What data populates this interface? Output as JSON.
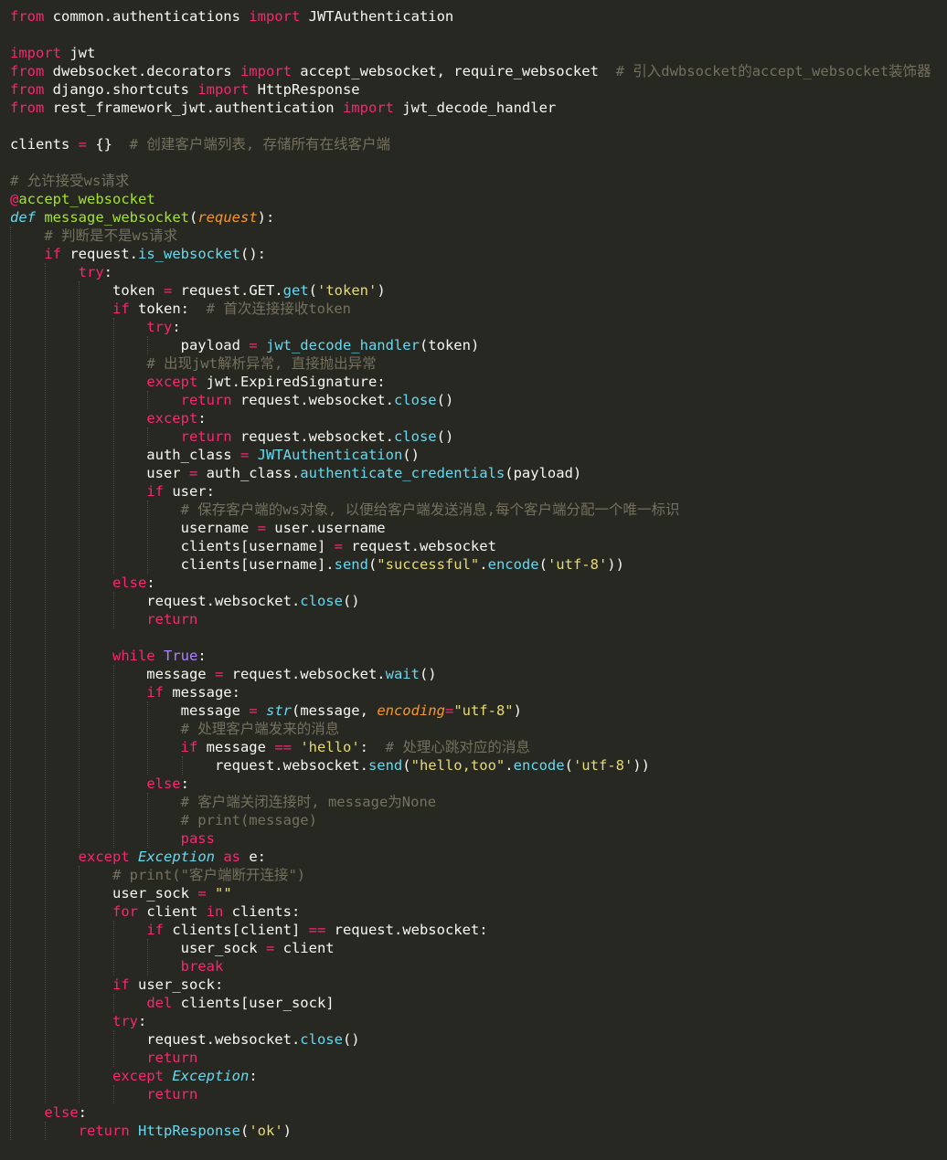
{
  "editor": {
    "theme_colors": {
      "background": "#272822",
      "text": "#f8f8f2",
      "keyword": "#f92672",
      "function": "#a6e22e",
      "builtin": "#66d9ef",
      "string": "#e6db74",
      "comment": "#75715e",
      "parameter": "#fd971f",
      "constant": "#ae81ff"
    },
    "lines": [
      [
        [
          "kw",
          "from"
        ],
        [
          "txt",
          " common.authentications "
        ],
        [
          "kw",
          "import"
        ],
        [
          "txt",
          " JWTAuthentication"
        ]
      ],
      [],
      [
        [
          "kw",
          "import"
        ],
        [
          "txt",
          " jwt"
        ]
      ],
      [
        [
          "kw",
          "from"
        ],
        [
          "txt",
          " dwebsocket.decorators "
        ],
        [
          "kw",
          "import"
        ],
        [
          "txt",
          " accept_websocket, require_websocket  "
        ],
        [
          "cm",
          "# 引入dwbsocket的accept_websocket装饰器"
        ]
      ],
      [
        [
          "kw",
          "from"
        ],
        [
          "txt",
          " django.shortcuts "
        ],
        [
          "kw",
          "import"
        ],
        [
          "txt",
          " HttpResponse"
        ]
      ],
      [
        [
          "kw",
          "from"
        ],
        [
          "txt",
          " rest_framework_jwt.authentication "
        ],
        [
          "kw",
          "import"
        ],
        [
          "txt",
          " jwt_decode_handler"
        ]
      ],
      [],
      [
        [
          "txt",
          "clients "
        ],
        [
          "op",
          "="
        ],
        [
          "txt",
          " {}  "
        ],
        [
          "cm",
          "# 创建客户端列表, 存储所有在线客户端"
        ]
      ],
      [],
      [
        [
          "cm",
          "# 允许接受ws请求"
        ]
      ],
      [
        [
          "dec",
          "@"
        ],
        [
          "fn",
          "accept_websocket"
        ]
      ],
      [
        [
          "cls",
          "def"
        ],
        [
          "txt",
          " "
        ],
        [
          "fn",
          "message_websocket"
        ],
        [
          "txt",
          "("
        ],
        [
          "prm",
          "request"
        ],
        [
          "txt",
          "):"
        ]
      ],
      [
        [
          "txt",
          "    "
        ],
        [
          "cm",
          "# 判断是不是ws请求"
        ]
      ],
      [
        [
          "txt",
          "    "
        ],
        [
          "kw",
          "if"
        ],
        [
          "txt",
          " request."
        ],
        [
          "bi",
          "is_websocket"
        ],
        [
          "txt",
          "():"
        ]
      ],
      [
        [
          "txt",
          "        "
        ],
        [
          "kw",
          "try"
        ],
        [
          "txt",
          ":"
        ]
      ],
      [
        [
          "txt",
          "            token "
        ],
        [
          "op",
          "="
        ],
        [
          "txt",
          " request.GET."
        ],
        [
          "bi",
          "get"
        ],
        [
          "txt",
          "("
        ],
        [
          "str",
          "'token'"
        ],
        [
          "txt",
          ")"
        ]
      ],
      [
        [
          "txt",
          "            "
        ],
        [
          "kw",
          "if"
        ],
        [
          "txt",
          " token:  "
        ],
        [
          "cm",
          "# 首次连接接收token"
        ]
      ],
      [
        [
          "txt",
          "                "
        ],
        [
          "kw",
          "try"
        ],
        [
          "txt",
          ":"
        ]
      ],
      [
        [
          "txt",
          "                    payload "
        ],
        [
          "op",
          "="
        ],
        [
          "txt",
          " "
        ],
        [
          "bi",
          "jwt_decode_handler"
        ],
        [
          "txt",
          "(token)"
        ]
      ],
      [
        [
          "txt",
          "                "
        ],
        [
          "cm",
          "# 出现jwt解析异常, 直接抛出异常"
        ]
      ],
      [
        [
          "txt",
          "                "
        ],
        [
          "kw",
          "except"
        ],
        [
          "txt",
          " jwt.ExpiredSignature:"
        ]
      ],
      [
        [
          "txt",
          "                    "
        ],
        [
          "kw",
          "return"
        ],
        [
          "txt",
          " request.websocket."
        ],
        [
          "bi",
          "close"
        ],
        [
          "txt",
          "()"
        ]
      ],
      [
        [
          "txt",
          "                "
        ],
        [
          "kw",
          "except"
        ],
        [
          "txt",
          ":"
        ]
      ],
      [
        [
          "txt",
          "                    "
        ],
        [
          "kw",
          "return"
        ],
        [
          "txt",
          " request.websocket."
        ],
        [
          "bi",
          "close"
        ],
        [
          "txt",
          "()"
        ]
      ],
      [
        [
          "txt",
          "                auth_class "
        ],
        [
          "op",
          "="
        ],
        [
          "txt",
          " "
        ],
        [
          "bi",
          "JWTAuthentication"
        ],
        [
          "txt",
          "()"
        ]
      ],
      [
        [
          "txt",
          "                user "
        ],
        [
          "op",
          "="
        ],
        [
          "txt",
          " auth_class."
        ],
        [
          "bi",
          "authenticate_credentials"
        ],
        [
          "txt",
          "(payload)"
        ]
      ],
      [
        [
          "txt",
          "                "
        ],
        [
          "kw",
          "if"
        ],
        [
          "txt",
          " user:"
        ]
      ],
      [
        [
          "txt",
          "                    "
        ],
        [
          "cm",
          "# 保存客户端的ws对象, 以便给客户端发送消息,每个客户端分配一个唯一标识"
        ]
      ],
      [
        [
          "txt",
          "                    username "
        ],
        [
          "op",
          "="
        ],
        [
          "txt",
          " user.username"
        ]
      ],
      [
        [
          "txt",
          "                    clients[username] "
        ],
        [
          "op",
          "="
        ],
        [
          "txt",
          " request.websocket"
        ]
      ],
      [
        [
          "txt",
          "                    clients[username]."
        ],
        [
          "bi",
          "send"
        ],
        [
          "txt",
          "("
        ],
        [
          "str",
          "\"successful\""
        ],
        [
          "txt",
          "."
        ],
        [
          "bi",
          "encode"
        ],
        [
          "txt",
          "("
        ],
        [
          "str",
          "'utf-8'"
        ],
        [
          "txt",
          "))"
        ]
      ],
      [
        [
          "txt",
          "            "
        ],
        [
          "kw",
          "else"
        ],
        [
          "txt",
          ":"
        ]
      ],
      [
        [
          "txt",
          "                request.websocket."
        ],
        [
          "bi",
          "close"
        ],
        [
          "txt",
          "()"
        ]
      ],
      [
        [
          "txt",
          "                "
        ],
        [
          "kw",
          "return"
        ]
      ],
      [],
      [
        [
          "txt",
          "            "
        ],
        [
          "kw",
          "while"
        ],
        [
          "txt",
          " "
        ],
        [
          "con",
          "True"
        ],
        [
          "txt",
          ":"
        ]
      ],
      [
        [
          "txt",
          "                message "
        ],
        [
          "op",
          "="
        ],
        [
          "txt",
          " request.websocket."
        ],
        [
          "bi",
          "wait"
        ],
        [
          "txt",
          "()"
        ]
      ],
      [
        [
          "txt",
          "                "
        ],
        [
          "kw",
          "if"
        ],
        [
          "txt",
          " message:"
        ]
      ],
      [
        [
          "txt",
          "                    message "
        ],
        [
          "op",
          "="
        ],
        [
          "txt",
          " "
        ],
        [
          "cls",
          "str"
        ],
        [
          "txt",
          "(message, "
        ],
        [
          "prm",
          "encoding"
        ],
        [
          "op",
          "="
        ],
        [
          "str",
          "\"utf-8\""
        ],
        [
          "txt",
          ")"
        ]
      ],
      [
        [
          "txt",
          "                    "
        ],
        [
          "cm",
          "# 处理客户端发来的消息"
        ]
      ],
      [
        [
          "txt",
          "                    "
        ],
        [
          "kw",
          "if"
        ],
        [
          "txt",
          " message "
        ],
        [
          "op",
          "=="
        ],
        [
          "txt",
          " "
        ],
        [
          "str",
          "'hello'"
        ],
        [
          "txt",
          ":  "
        ],
        [
          "cm",
          "# 处理心跳对应的消息"
        ]
      ],
      [
        [
          "txt",
          "                        request.websocket."
        ],
        [
          "bi",
          "send"
        ],
        [
          "txt",
          "("
        ],
        [
          "str",
          "\"hello,too\""
        ],
        [
          "txt",
          "."
        ],
        [
          "bi",
          "encode"
        ],
        [
          "txt",
          "("
        ],
        [
          "str",
          "'utf-8'"
        ],
        [
          "txt",
          "))"
        ]
      ],
      [
        [
          "txt",
          "                "
        ],
        [
          "kw",
          "else"
        ],
        [
          "txt",
          ":"
        ]
      ],
      [
        [
          "txt",
          "                    "
        ],
        [
          "cm",
          "# 客户端关闭连接时, message为None"
        ]
      ],
      [
        [
          "txt",
          "                    "
        ],
        [
          "cm",
          "# print(message)"
        ]
      ],
      [
        [
          "txt",
          "                    "
        ],
        [
          "kw",
          "pass"
        ]
      ],
      [
        [
          "txt",
          "        "
        ],
        [
          "kw",
          "except"
        ],
        [
          "txt",
          " "
        ],
        [
          "cls",
          "Exception"
        ],
        [
          "txt",
          " "
        ],
        [
          "kw",
          "as"
        ],
        [
          "txt",
          " e:"
        ]
      ],
      [
        [
          "txt",
          "            "
        ],
        [
          "cm",
          "# print(\"客户端断开连接\")"
        ]
      ],
      [
        [
          "txt",
          "            user_sock "
        ],
        [
          "op",
          "="
        ],
        [
          "txt",
          " "
        ],
        [
          "str",
          "\"\""
        ]
      ],
      [
        [
          "txt",
          "            "
        ],
        [
          "kw",
          "for"
        ],
        [
          "txt",
          " client "
        ],
        [
          "kw",
          "in"
        ],
        [
          "txt",
          " clients:"
        ]
      ],
      [
        [
          "txt",
          "                "
        ],
        [
          "kw",
          "if"
        ],
        [
          "txt",
          " clients[client] "
        ],
        [
          "op",
          "=="
        ],
        [
          "txt",
          " request.websocket:"
        ]
      ],
      [
        [
          "txt",
          "                    user_sock "
        ],
        [
          "op",
          "="
        ],
        [
          "txt",
          " client"
        ]
      ],
      [
        [
          "txt",
          "                    "
        ],
        [
          "kw",
          "break"
        ]
      ],
      [
        [
          "txt",
          "            "
        ],
        [
          "kw",
          "if"
        ],
        [
          "txt",
          " user_sock:"
        ]
      ],
      [
        [
          "txt",
          "                "
        ],
        [
          "kw",
          "del"
        ],
        [
          "txt",
          " clients[user_sock]"
        ]
      ],
      [
        [
          "txt",
          "            "
        ],
        [
          "kw",
          "try"
        ],
        [
          "txt",
          ":"
        ]
      ],
      [
        [
          "txt",
          "                request.websocket."
        ],
        [
          "bi",
          "close"
        ],
        [
          "txt",
          "()"
        ]
      ],
      [
        [
          "txt",
          "                "
        ],
        [
          "kw",
          "return"
        ]
      ],
      [
        [
          "txt",
          "            "
        ],
        [
          "kw",
          "except"
        ],
        [
          "txt",
          " "
        ],
        [
          "cls",
          "Exception"
        ],
        [
          "txt",
          ":"
        ]
      ],
      [
        [
          "txt",
          "                "
        ],
        [
          "kw",
          "return"
        ]
      ],
      [
        [
          "txt",
          "    "
        ],
        [
          "kw",
          "else"
        ],
        [
          "txt",
          ":"
        ]
      ],
      [
        [
          "txt",
          "        "
        ],
        [
          "kw",
          "return"
        ],
        [
          "txt",
          " "
        ],
        [
          "bi",
          "HttpResponse"
        ],
        [
          "txt",
          "("
        ],
        [
          "str",
          "'ok'"
        ],
        [
          "txt",
          ")"
        ]
      ]
    ]
  }
}
